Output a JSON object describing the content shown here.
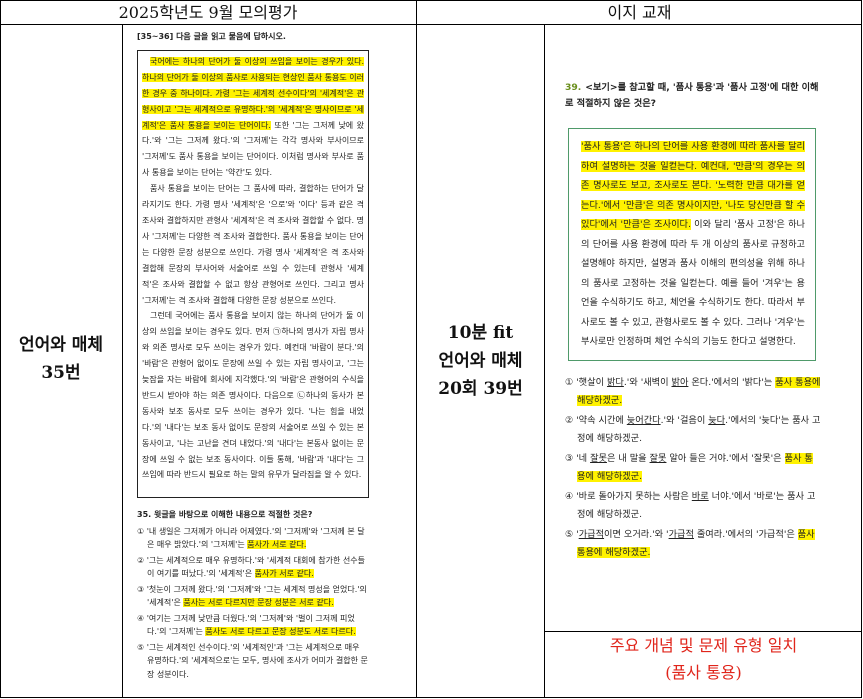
{
  "header": {
    "left": "2025학년도 9월 모의평가",
    "right": "이지 교재"
  },
  "left_label": {
    "line1": "언어와 매체",
    "line2": "35번"
  },
  "mid_label": {
    "line1": "10분 fit",
    "line2": "언어와 매체",
    "line3": "20회 39번"
  },
  "scan": {
    "title": "[35~36] 다음 글을 읽고 물음에 답하시오.",
    "para1_hl": "국어에는 하나의 단어가 둘 이상의 쓰임을 보이는 경우가 있다. 하나의 단어가 둘 이상의 품사로 사용되는 현상인 품사 통용도 이러한 경우 중 하나이다. 가령 '그는 세계적 선수이다'의 '세계적'은 관형사이고 '그는 세계적으로 유명하다.'의 '세계적'은 명사이므로 '세계적'은 품사 통용을 보이는 단어이다.",
    "para1_rest": "또한 '그는 그저께 낮에 왔다.'와 '그는 그저께 왔다.'의 '그저께'는 각각 명사와 부사이므로 '그저께'도 품사 통용을 보이는 단어이다. 이처럼 명사와 부사로 품사 통용을 보이는 단어는 '약간'도 있다.",
    "para2": "품사 통용을 보이는 단어는 그 품사에 따라, 결합하는 단어가 달라지기도 한다. 가령 명사 '세계적'은 '으로'와 '이다' 등과 같은 격 조사와 결합하지만 관형사 '세계적'은 격 조사와 결합할 수 없다. 명사 '그저께'는 다양한 격 조사와 결합한다. 품사 통용을 보이는 단어는 다양한 문장 성분으로 쓰인다. 가령 명사 '세계적'은 격 조사와 결합해 문장의 부사어와 서술어로 쓰일 수 있는데 관형사 '세계적'은 조사와 결합할 수 없고 항상 관형어로 쓰인다. 그리고 명사 '그저께'는 격 조사와 결합해 다양한 문장 성분으로 쓰인다.",
    "para3": "그런데 국어에는 품사 통용을 보이지 않는 하나의 단어가 둘 이상의 쓰임을 보이는 경우도 있다. 먼저 ㉠하나의 명사가 자립 명사와 의존 명사로 모두 쓰이는 경우가 있다. 예컨대 '바람이 분다.'의 '바람'은 관형어 없이도 문장에 쓰일 수 있는 자립 명사이고, '그는 늦잠을 자는 바람에 회사에 지각했다.'의 '바람'은 관형어의 수식을 반드시 받아야 하는 의존 명사이다. 다음으로 ㉡하나의 동사가 본동사와 보조 동사로 모두 쓰이는 경우가 있다. '나는 힘을 내었다.'의 '내다'는 보조 동사 없이도 문장의 서술어로 쓰일 수 있는 본동사이고, '나는 고난을 견뎌 내었다.'의 '내다'는 본동사 없이는 문장에 쓰일 수 없는 보조 동사이다. 이들 통해, '바람'과 '내다'는 그 쓰임에 따라 반드시 필요로 하는 말의 유무가 달라짐을 알 수 있다.",
    "q_title": "35. 윗글을 바탕으로 이해한 내용으로 적절한 것은?",
    "options": [
      {
        "pre": "① '내 생일은 그저께가 아니라 어제였다.'의 '그저께'와 '그저께 본 달은 매우 밝았다.'의 '그저께'는 ",
        "hl": "품사가 서로 같다.",
        "post": ""
      },
      {
        "pre": "② '그는 세계적으로 매우 유명하다.'와 '세계적 대회에 참가한 선수들이 여기를 떠났다.'의 '세계적'은 ",
        "hl": "품사가 서로 같다.",
        "post": ""
      },
      {
        "pre": "③ '첫눈이 그저께 왔다.'의 '그저께'와 '그는 세계적 명성을 얻었다.'의 '세계적'은 ",
        "hl": "품사는 서로 다르지만 문장 성분은 서로 같다.",
        "post": ""
      },
      {
        "pre": "④ '여기는 그저께 낮만큼 더웠다.'의 '그저께'와 '벌이 그저께 피었다.'의 '그저께'는 ",
        "hl": "품사도 서로 다르고 문장 성분도 서로 다르다.",
        "post": ""
      },
      {
        "pre": "⑤ '그는 세계적인 선수이다.'의 '세계적인'과 '그는 세계적으로 매우 유명하다.'의 '세계적으로'는 모두, 명사에 조사가 어미가 결합한 문장 성분이다.",
        "hl": "",
        "post": ""
      }
    ]
  },
  "right_page": {
    "q_num": "39.",
    "q_text": "<보기>를 참고할 때, '품사 통용'과 '품사 고정'에 대한 이해로 적절하지 않은 것은?",
    "box_hl": "'품사 통용'은 하나의 단어를 사용 환경에 따라 품사를 달리하여 설명하는 것을 일컫는다. 예컨대, '만큼'의 경우는 의존 명사로도 보고, 조사로도 본다. '노력한 만큼 대가를 얻는다.'에서 '만큼'은 의존 명사이지만, '나도 당신만큼 할 수 있다'에서 '만큼'은 조사이다.",
    "box_rest": " 이와 달리 '품사 고정'은 하나의 단어를 사용 환경에 따라 두 개 이상의 품사로 규정하고 설명해야 하지만, 설명과 품사 이해의 편의성을 위해 하나의 품사로 고정하는 것을 일컫는다. 예를 들어 '겨우'는 용언을 수식하기도 하고, 체언을 수식하기도 한다. 따라서 부사로도 볼 수 있고, 관형사로도 볼 수 있다. 그러나 '겨우'는 부사로만 인정하며 체언 수식의 기능도 한다고 설명한다.",
    "options": [
      {
        "a": "① '햇살이 ",
        "u": "밝다",
        "b": ".'와 '새벽이 ",
        "u2": "밝아",
        "c": " 온다.'에서의 '밝다'는 ",
        "hl": "품사 통용에 해당하겠군.",
        "d": ""
      },
      {
        "a": "② '약속 시간에 ",
        "u": "늦어간다",
        "b": ".'와 '걸음이 ",
        "u2": "늦다",
        "c": ".'에서의 '늦다'는 품사 고정에 해당하겠군.",
        "hl": "",
        "d": ""
      },
      {
        "a": "③ '네 ",
        "u": "잘못",
        "b": "은 내 말을 ",
        "u2": "잘못",
        "c": " 알아 들은 거야.'에서 '잘못'은 ",
        "hl": "품사 통용에 해당하겠군.",
        "d": ""
      },
      {
        "a": "④ '바로 돌아가지 못하는 사람은 ",
        "u": "바로",
        "b": " 너야.'에서 '바로'는 품사 고정에 해당하겠군.",
        "u2": "",
        "c": "",
        "hl": "",
        "d": ""
      },
      {
        "a": "⑤ '",
        "u": "가급적",
        "b": "이면 오거라.'와 '",
        "u2": "가급적",
        "c": " 줄여라.'에서의 '가급적'은 ",
        "hl": "품사 통용에 해당하겠군.",
        "d": ""
      }
    ]
  },
  "note": {
    "line1": "주요 개념 및 문제 유형 일치",
    "line2": "(품사 통용)"
  }
}
